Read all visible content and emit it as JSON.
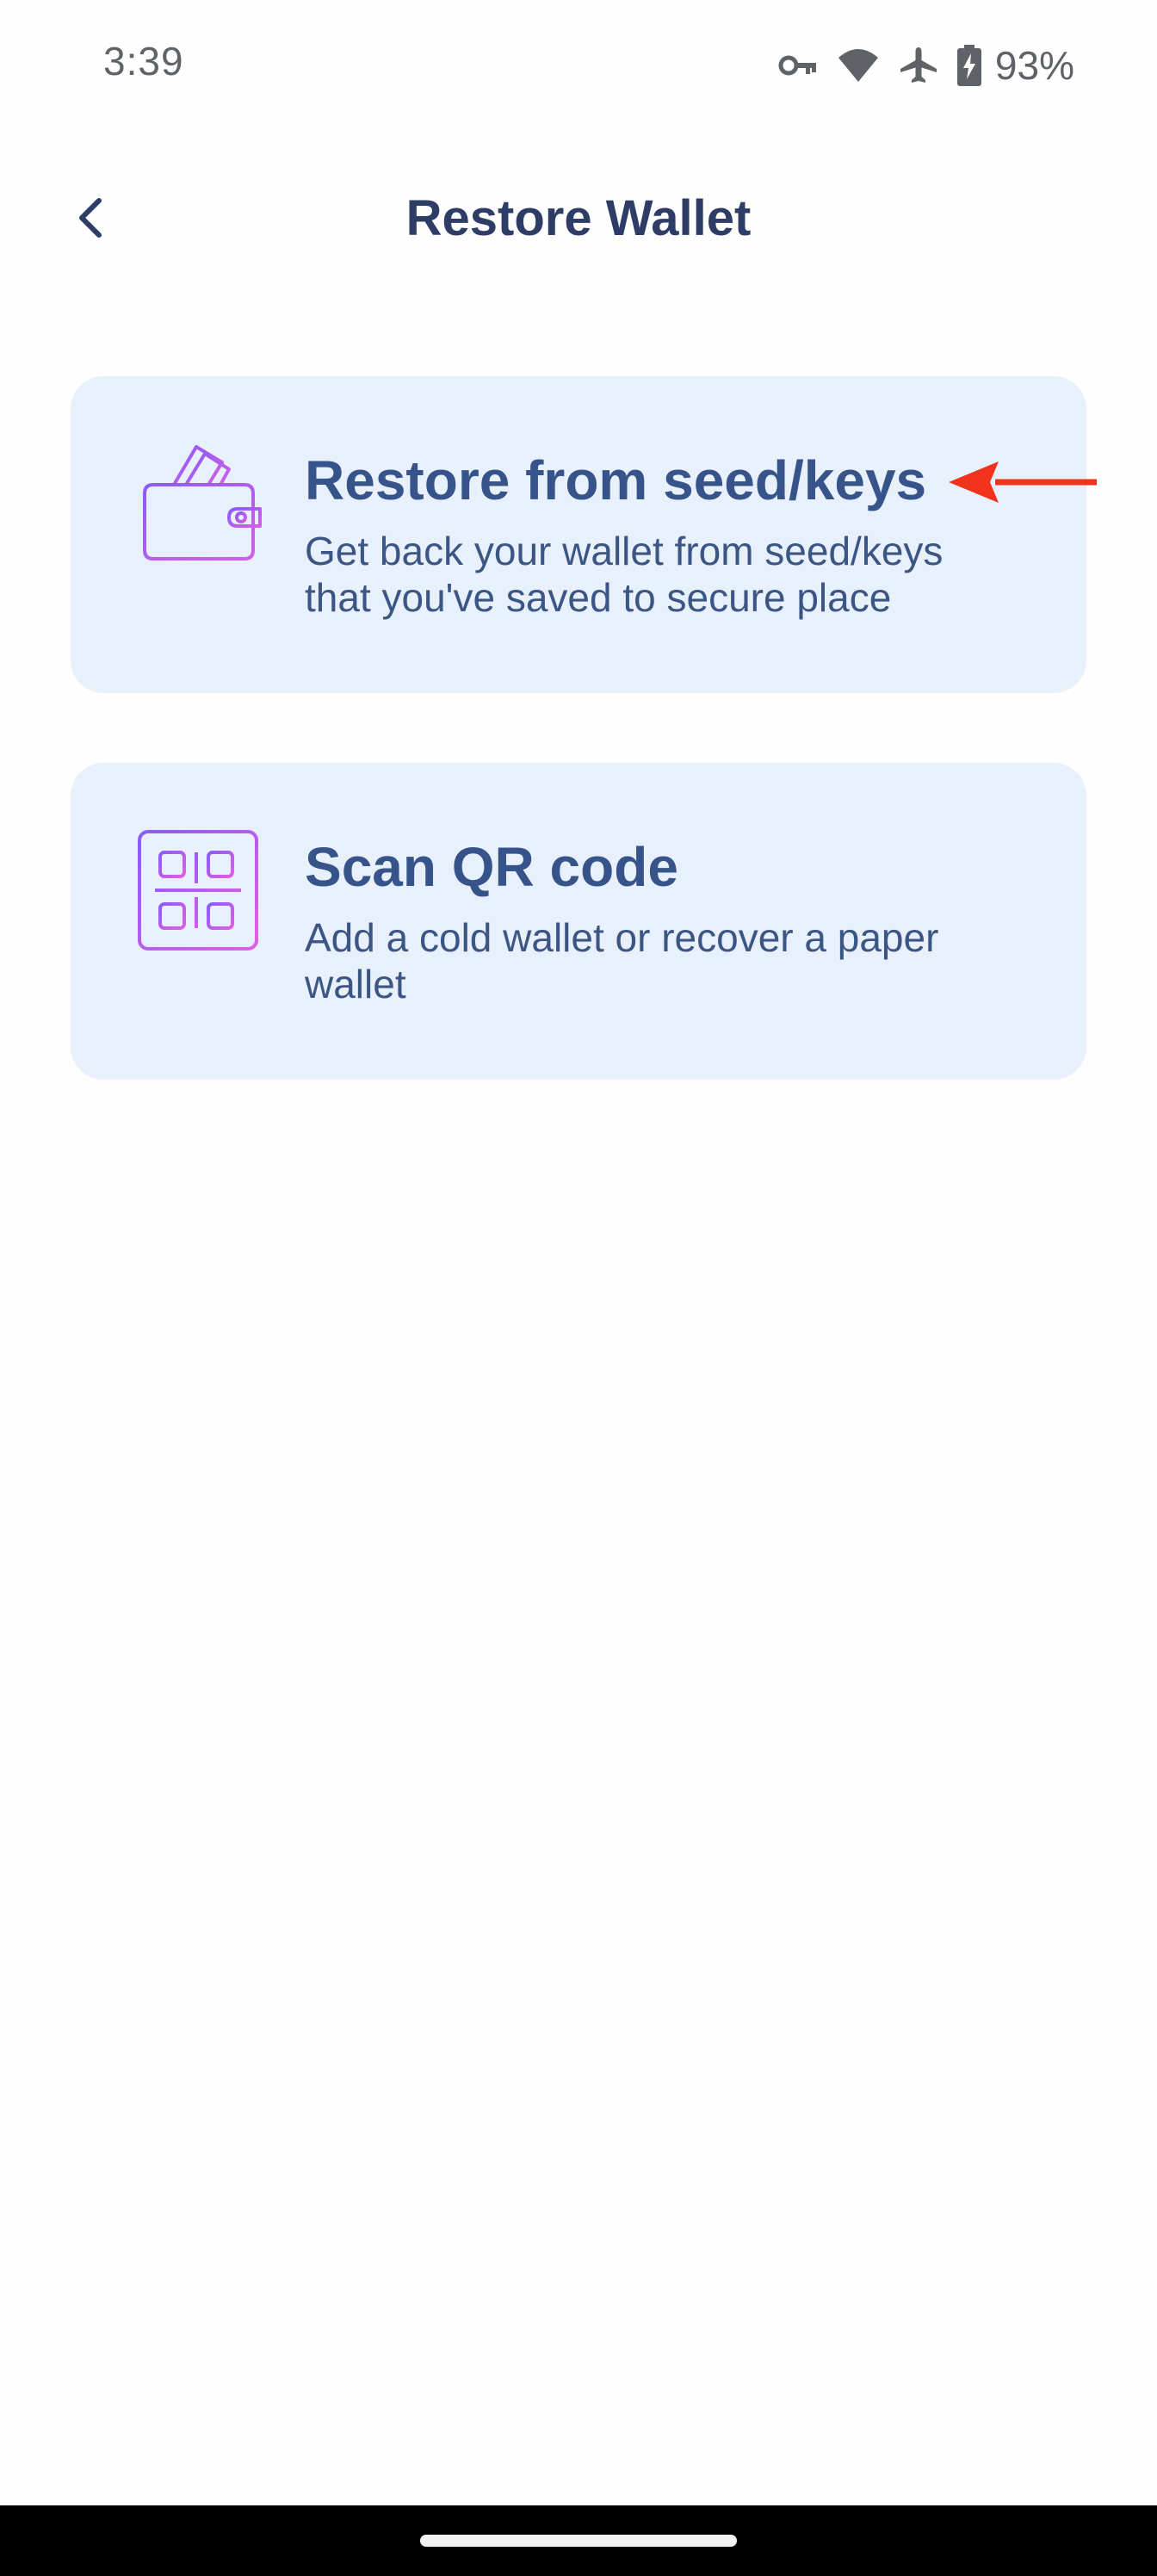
{
  "status_bar": {
    "time": "3:39",
    "battery_percent": "93%",
    "icons": [
      "vpn-key-icon",
      "wifi-icon",
      "airplane-icon",
      "battery-charging-icon"
    ]
  },
  "header": {
    "title": "Restore Wallet",
    "back_icon": "chevron-left-icon"
  },
  "options": [
    {
      "icon": "wallet-icon",
      "title": "Restore from seed/keys",
      "description": "Get back your wallet from seed/keys that you've saved to secure place"
    },
    {
      "icon": "qr-code-icon",
      "title": "Scan QR code",
      "description": "Add a cold wallet or recover a paper wallet"
    }
  ],
  "colors": {
    "card_background": "#e8f0fb",
    "title_text": "#36538a",
    "header_text": "#2d3d66",
    "icon_gradient_start": "#8a5cf6",
    "icon_gradient_end": "#e05ee6",
    "annotation_arrow": "#f2331b"
  }
}
